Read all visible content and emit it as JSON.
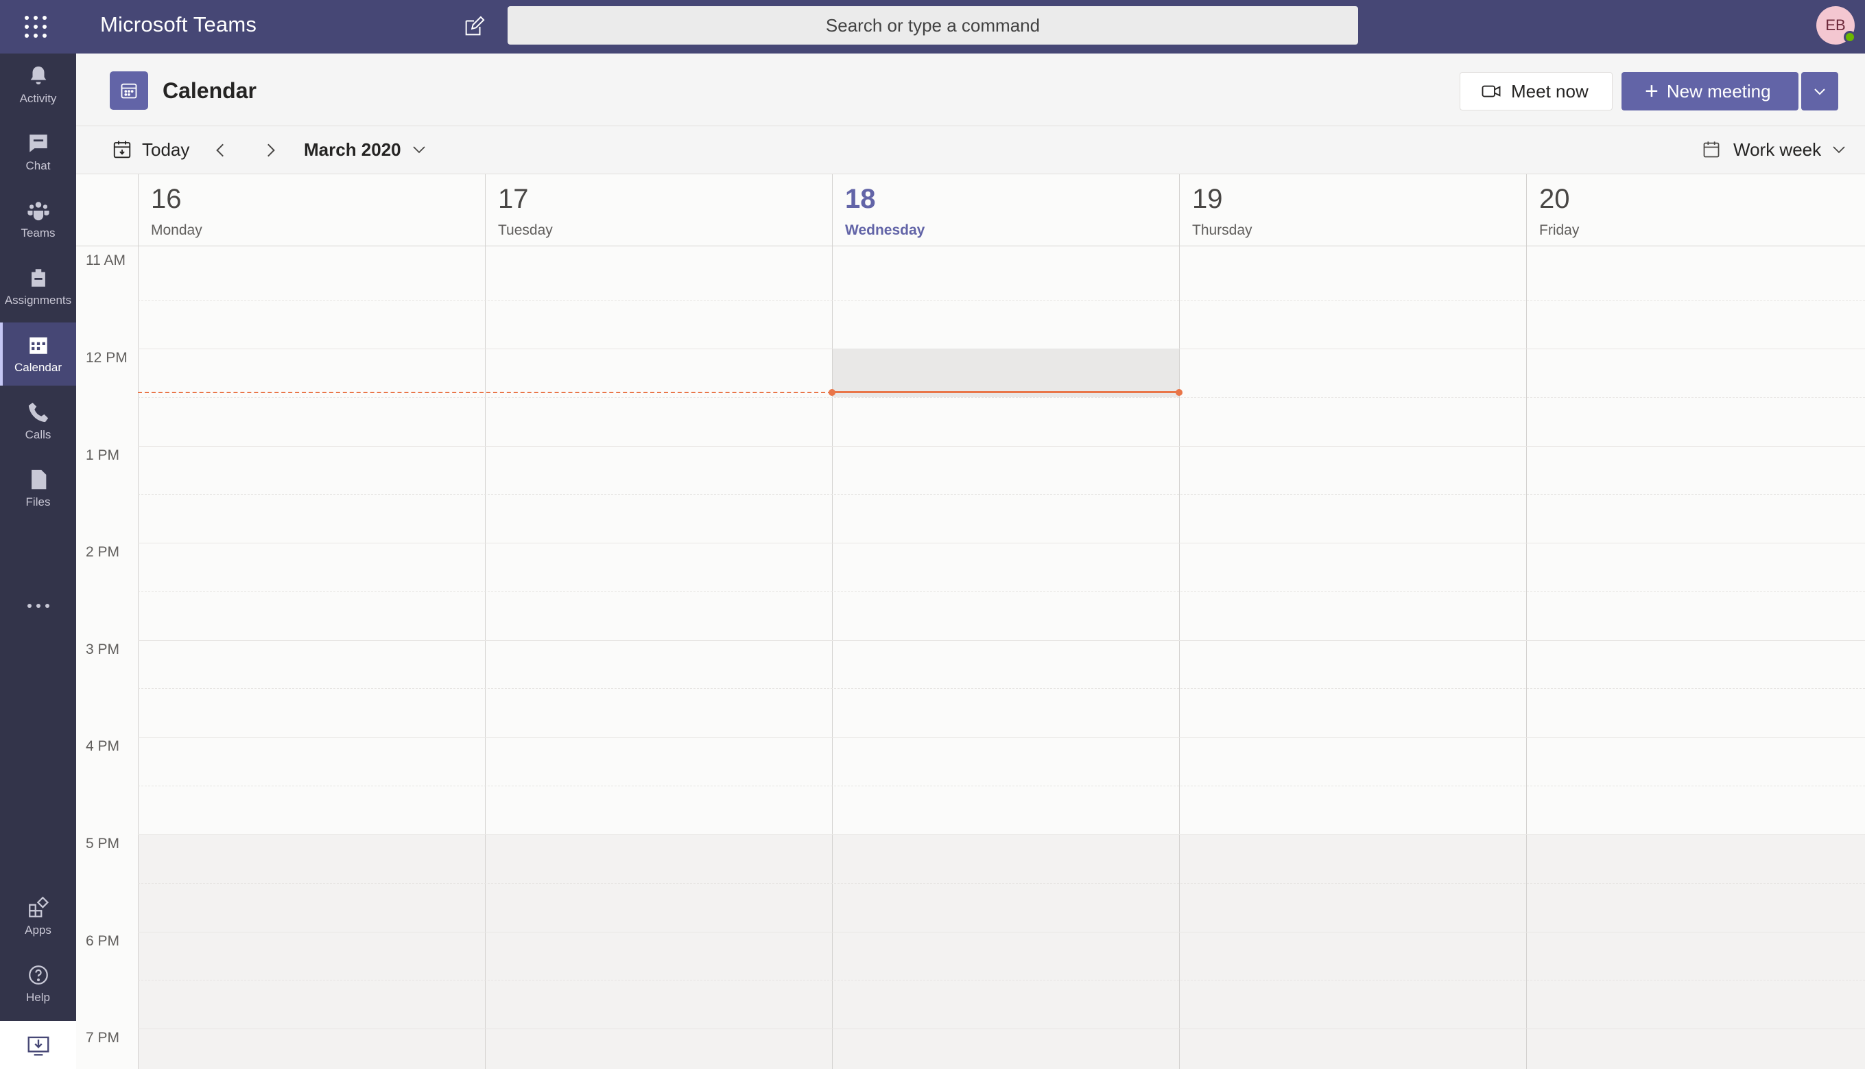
{
  "app": {
    "title": "Microsoft Teams"
  },
  "search": {
    "placeholder": "Search or type a command"
  },
  "user": {
    "initials": "EB",
    "presence": "available"
  },
  "rail": {
    "items": [
      {
        "label": "Activity",
        "icon": "bell-icon"
      },
      {
        "label": "Chat",
        "icon": "chat-icon"
      },
      {
        "label": "Teams",
        "icon": "teams-icon"
      },
      {
        "label": "Assignments",
        "icon": "assignments-icon"
      },
      {
        "label": "Calendar",
        "icon": "calendar-icon",
        "active": true
      },
      {
        "label": "Calls",
        "icon": "phone-icon"
      },
      {
        "label": "Files",
        "icon": "file-icon"
      }
    ],
    "bottom": [
      {
        "label": "Apps",
        "icon": "apps-icon"
      },
      {
        "label": "Help",
        "icon": "help-icon"
      }
    ]
  },
  "header": {
    "title": "Calendar",
    "meet_now": "Meet now",
    "new_meeting": "New meeting"
  },
  "toolbar": {
    "today": "Today",
    "month": "March 2020",
    "view": "Work week"
  },
  "days": [
    {
      "num": "16",
      "name": "Monday"
    },
    {
      "num": "17",
      "name": "Tuesday"
    },
    {
      "num": "18",
      "name": "Wednesday",
      "today": true
    },
    {
      "num": "19",
      "name": "Thursday"
    },
    {
      "num": "20",
      "name": "Friday"
    }
  ],
  "times": [
    "11 AM",
    "12 PM",
    "1 PM",
    "2 PM",
    "3 PM",
    "4 PM",
    "5 PM",
    "6 PM",
    "7 PM"
  ],
  "colors": {
    "brand": "#6264a7",
    "topbar": "#464775",
    "rail": "#33344a",
    "now_line": "#e97548"
  }
}
